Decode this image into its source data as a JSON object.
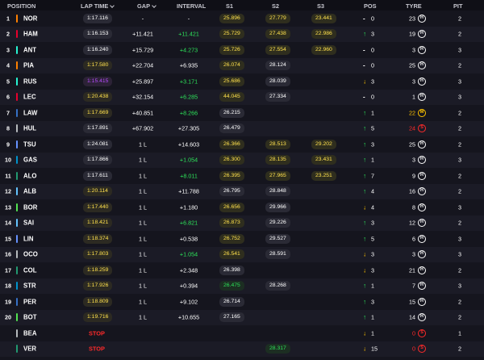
{
  "headers": {
    "position": "POSITION",
    "lap_time": "LAP TIME",
    "gap": "GAP",
    "interval": "INTERVAL",
    "s1": "S1",
    "s2": "S2",
    "s3": "S3",
    "pos": "POS",
    "tyre": "TYRE",
    "pit": "PIT"
  },
  "colors": {
    "background": "#15151e",
    "personal_best": "#ffe14d",
    "fastest": "#b74bff",
    "gain": "#2de35a",
    "loss": "#ffc400",
    "stop": "#ff2a2a"
  },
  "rows": [
    {
      "pos": "1",
      "team": "#ff8000",
      "driver": "NOR",
      "lap": "1:17.116",
      "lap_style": "normal",
      "gap": "-",
      "interval": "-",
      "int_style": "white",
      "s1": "25.896",
      "s1_style": "pb",
      "s2": "27.779",
      "s2_style": "pb",
      "s3": "23.441",
      "s3_style": "pb",
      "arrow": "-",
      "arrow_style": "same",
      "poschg": "0",
      "tyre_laps": "23",
      "tyre_style": "white",
      "tyre": "H",
      "tyre_color": "#ffffff",
      "pit": "2"
    },
    {
      "pos": "2",
      "team": "#e8002d",
      "driver": "HAM",
      "lap": "1:16.153",
      "lap_style": "normal",
      "gap": "+11.421",
      "interval": "+11.421",
      "int_style": "green",
      "s1": "25.729",
      "s1_style": "pb",
      "s2": "27.438",
      "s2_style": "pb",
      "s3": "22.986",
      "s3_style": "pb",
      "arrow": "↑",
      "arrow_style": "up",
      "poschg": "3",
      "tyre_laps": "19",
      "tyre_style": "white",
      "tyre": "H",
      "tyre_color": "#ffffff",
      "pit": "2"
    },
    {
      "pos": "3",
      "team": "#27f4d2",
      "driver": "ANT",
      "lap": "1:16.240",
      "lap_style": "normal",
      "gap": "+15.729",
      "interval": "+4.273",
      "int_style": "green",
      "s1": "25.726",
      "s1_style": "pb",
      "s2": "27.554",
      "s2_style": "pb",
      "s3": "22.960",
      "s3_style": "pb",
      "arrow": "-",
      "arrow_style": "same",
      "poschg": "0",
      "tyre_laps": "3",
      "tyre_style": "white",
      "tyre": "H",
      "tyre_color": "#ffffff",
      "pit": "3"
    },
    {
      "pos": "4",
      "team": "#ff8000",
      "driver": "PIA",
      "lap": "1:17.580",
      "lap_style": "pb",
      "gap": "+22.704",
      "interval": "+6.935",
      "int_style": "white",
      "s1": "26.074",
      "s1_style": "pb",
      "s2": "28.124",
      "s2_style": "white",
      "s3": "",
      "s3_style": "none",
      "arrow": "-",
      "arrow_style": "same",
      "poschg": "0",
      "tyre_laps": "25",
      "tyre_style": "white",
      "tyre": "H",
      "tyre_color": "#ffffff",
      "pit": "2"
    },
    {
      "pos": "5",
      "team": "#27f4d2",
      "driver": "RUS",
      "lap": "1:15.415",
      "lap_style": "fastest",
      "gap": "+25.897",
      "interval": "+3.171",
      "int_style": "green",
      "s1": "25.686",
      "s1_style": "pb",
      "s2": "28.039",
      "s2_style": "white",
      "s3": "",
      "s3_style": "none",
      "arrow": "↓",
      "arrow_style": "down",
      "poschg": "3",
      "tyre_laps": "3",
      "tyre_style": "white",
      "tyre": "H",
      "tyre_color": "#ffffff",
      "pit": "3"
    },
    {
      "pos": "6",
      "team": "#e8002d",
      "driver": "LEC",
      "lap": "1:20.438",
      "lap_style": "pb",
      "gap": "+32.154",
      "interval": "+6.285",
      "int_style": "green",
      "s1": "44.045",
      "s1_style": "pb",
      "s2": "27.334",
      "s2_style": "white",
      "s3": "",
      "s3_style": "none",
      "arrow": "-",
      "arrow_style": "same",
      "poschg": "0",
      "tyre_laps": "1",
      "tyre_style": "white",
      "tyre": "H",
      "tyre_color": "#ffffff",
      "pit": "3"
    },
    {
      "pos": "7",
      "team": "#3671c6",
      "driver": "LAW",
      "lap": "1:17.669",
      "lap_style": "pb",
      "gap": "+40.851",
      "interval": "+8.266",
      "int_style": "green",
      "s1": "26.215",
      "s1_style": "white",
      "s2": "",
      "s2_style": "none",
      "s3": "",
      "s3_style": "none",
      "arrow": "↑",
      "arrow_style": "up",
      "poschg": "1",
      "tyre_laps": "22",
      "tyre_style": "yellow",
      "tyre": "M",
      "tyre_color": "#ffc400",
      "pit": "2"
    },
    {
      "pos": "8",
      "team": "#b6babd",
      "driver": "HUL",
      "lap": "1:17.891",
      "lap_style": "normal",
      "gap": "+67.902",
      "interval": "+27.305",
      "int_style": "white",
      "s1": "26.479",
      "s1_style": "white",
      "s2": "",
      "s2_style": "none",
      "s3": "",
      "s3_style": "none",
      "arrow": "↑",
      "arrow_style": "up",
      "poschg": "5",
      "tyre_laps": "24",
      "tyre_style": "red",
      "tyre": "S",
      "tyre_color": "#ff2a2a",
      "pit": "2"
    },
    {
      "pos": "9",
      "team": "#6692ff",
      "driver": "TSU",
      "lap": "1:24.081",
      "lap_style": "normal",
      "gap": "1 L",
      "interval": "+14.603",
      "int_style": "white",
      "s1": "26.366",
      "s1_style": "pb",
      "s2": "28.513",
      "s2_style": "pb",
      "s3": "29.202",
      "s3_style": "pb",
      "arrow": "↑",
      "arrow_style": "up",
      "poschg": "3",
      "tyre_laps": "25",
      "tyre_style": "white",
      "tyre": "H",
      "tyre_color": "#ffffff",
      "pit": "2"
    },
    {
      "pos": "10",
      "team": "#0093cc",
      "driver": "GAS",
      "lap": "1:17.866",
      "lap_style": "normal",
      "gap": "1 L",
      "interval": "+1.054",
      "int_style": "green",
      "s1": "26.300",
      "s1_style": "pb",
      "s2": "28.135",
      "s2_style": "pb",
      "s3": "23.431",
      "s3_style": "pb",
      "arrow": "↑",
      "arrow_style": "up",
      "poschg": "1",
      "tyre_laps": "3",
      "tyre_style": "white",
      "tyre": "H",
      "tyre_color": "#ffffff",
      "pit": "3"
    },
    {
      "pos": "11",
      "team": "#229971",
      "driver": "ALO",
      "lap": "1:17.611",
      "lap_style": "normal",
      "gap": "1 L",
      "interval": "+8.011",
      "int_style": "green",
      "s1": "26.395",
      "s1_style": "pb",
      "s2": "27.965",
      "s2_style": "pb",
      "s3": "23.251",
      "s3_style": "pb",
      "arrow": "↑",
      "arrow_style": "up",
      "poschg": "7",
      "tyre_laps": "9",
      "tyre_style": "white",
      "tyre": "H",
      "tyre_color": "#ffffff",
      "pit": "2"
    },
    {
      "pos": "12",
      "team": "#64c4ff",
      "driver": "ALB",
      "lap": "1:20.114",
      "lap_style": "pb",
      "gap": "1 L",
      "interval": "+11.788",
      "int_style": "white",
      "s1": "26.795",
      "s1_style": "white",
      "s2": "28.848",
      "s2_style": "white",
      "s3": "",
      "s3_style": "none",
      "arrow": "↑",
      "arrow_style": "up",
      "poschg": "4",
      "tyre_laps": "16",
      "tyre_style": "white",
      "tyre": "H",
      "tyre_color": "#ffffff",
      "pit": "2"
    },
    {
      "pos": "13",
      "team": "#52e252",
      "driver": "BOR",
      "lap": "1:17.440",
      "lap_style": "pb",
      "gap": "1 L",
      "interval": "+1.180",
      "int_style": "white",
      "s1": "26.656",
      "s1_style": "pb",
      "s2": "29.966",
      "s2_style": "white",
      "s3": "",
      "s3_style": "none",
      "arrow": "↓",
      "arrow_style": "down",
      "poschg": "4",
      "tyre_laps": "8",
      "tyre_style": "white",
      "tyre": "H",
      "tyre_color": "#ffffff",
      "pit": "3"
    },
    {
      "pos": "14",
      "team": "#64c4ff",
      "driver": "SAI",
      "lap": "1:18.421",
      "lap_style": "pb",
      "gap": "1 L",
      "interval": "+6.821",
      "int_style": "green",
      "s1": "26.873",
      "s1_style": "pb",
      "s2": "29.226",
      "s2_style": "white",
      "s3": "",
      "s3_style": "none",
      "arrow": "↑",
      "arrow_style": "up",
      "poschg": "3",
      "tyre_laps": "12",
      "tyre_style": "white",
      "tyre": "H",
      "tyre_color": "#ffffff",
      "pit": "2"
    },
    {
      "pos": "15",
      "team": "#6692ff",
      "driver": "LIN",
      "lap": "1:18.374",
      "lap_style": "pb",
      "gap": "1 L",
      "interval": "+0.538",
      "int_style": "white",
      "s1": "26.752",
      "s1_style": "pb",
      "s2": "29.527",
      "s2_style": "white",
      "s3": "",
      "s3_style": "none",
      "arrow": "↑",
      "arrow_style": "up",
      "poschg": "5",
      "tyre_laps": "6",
      "tyre_style": "white",
      "tyre": "H",
      "tyre_color": "#ffffff",
      "pit": "3"
    },
    {
      "pos": "16",
      "team": "#b6babd",
      "driver": "OCO",
      "lap": "1:17.803",
      "lap_style": "pb",
      "gap": "1 L",
      "interval": "+1.054",
      "int_style": "green",
      "s1": "26.541",
      "s1_style": "pb",
      "s2": "28.591",
      "s2_style": "white",
      "s3": "",
      "s3_style": "none",
      "arrow": "↓",
      "arrow_style": "down",
      "poschg": "3",
      "tyre_laps": "3",
      "tyre_style": "white",
      "tyre": "H",
      "tyre_color": "#ffffff",
      "pit": "3"
    },
    {
      "pos": "17",
      "team": "#229971",
      "driver": "COL",
      "lap": "1:18.259",
      "lap_style": "pb",
      "gap": "1 L",
      "interval": "+2.348",
      "int_style": "white",
      "s1": "26.398",
      "s1_style": "white",
      "s2": "",
      "s2_style": "none",
      "s3": "",
      "s3_style": "none",
      "arrow": "↓",
      "arrow_style": "down",
      "poschg": "3",
      "tyre_laps": "21",
      "tyre_style": "white",
      "tyre": "H",
      "tyre_color": "#ffffff",
      "pit": "2"
    },
    {
      "pos": "18",
      "team": "#0093cc",
      "driver": "STR",
      "lap": "1:17.926",
      "lap_style": "pb",
      "gap": "1 L",
      "interval": "+0.394",
      "int_style": "white",
      "s1": "26.475",
      "s1_style": "green",
      "s2": "28.268",
      "s2_style": "white",
      "s3": "",
      "s3_style": "none",
      "arrow": "↑",
      "arrow_style": "up",
      "poschg": "1",
      "tyre_laps": "7",
      "tyre_style": "white",
      "tyre": "H",
      "tyre_color": "#ffffff",
      "pit": "3"
    },
    {
      "pos": "19",
      "team": "#3671c6",
      "driver": "PER",
      "lap": "1:18.809",
      "lap_style": "pb",
      "gap": "1 L",
      "interval": "+9.102",
      "int_style": "white",
      "s1": "26.714",
      "s1_style": "white",
      "s2": "",
      "s2_style": "none",
      "s3": "",
      "s3_style": "none",
      "arrow": "↑",
      "arrow_style": "up",
      "poschg": "3",
      "tyre_laps": "15",
      "tyre_style": "white",
      "tyre": "H",
      "tyre_color": "#ffffff",
      "pit": "2"
    },
    {
      "pos": "20",
      "team": "#52e252",
      "driver": "BOT",
      "lap": "1:19.716",
      "lap_style": "pb",
      "gap": "1 L",
      "interval": "+10.655",
      "int_style": "white",
      "s1": "27.165",
      "s1_style": "white",
      "s2": "",
      "s2_style": "none",
      "s3": "",
      "s3_style": "none",
      "arrow": "↑",
      "arrow_style": "up",
      "poschg": "1",
      "tyre_laps": "14",
      "tyre_style": "white",
      "tyre": "H",
      "tyre_color": "#ffffff",
      "pit": "2"
    },
    {
      "pos": "",
      "team": "#b6babd",
      "driver": "BEA",
      "lap": "STOP",
      "lap_style": "stop",
      "gap": "",
      "interval": "",
      "int_style": "white",
      "s1": "",
      "s1_style": "none",
      "s2": "",
      "s2_style": "none",
      "s3": "",
      "s3_style": "none",
      "arrow": "↓",
      "arrow_style": "down",
      "poschg": "1",
      "tyre_laps": "0",
      "tyre_style": "red",
      "tyre": "S",
      "tyre_color": "#ff2a2a",
      "pit": "1"
    },
    {
      "pos": "",
      "team": "#229971",
      "driver": "VER",
      "lap": "STOP",
      "lap_style": "stop",
      "gap": "",
      "interval": "",
      "int_style": "white",
      "s1": "",
      "s1_style": "none",
      "s2": "28.317",
      "s2_style": "green",
      "s3": "",
      "s3_style": "none",
      "arrow": "↓",
      "arrow_style": "down",
      "poschg": "15",
      "tyre_laps": "0",
      "tyre_style": "red",
      "tyre": "S",
      "tyre_color": "#ff2a2a",
      "pit": "2"
    }
  ]
}
